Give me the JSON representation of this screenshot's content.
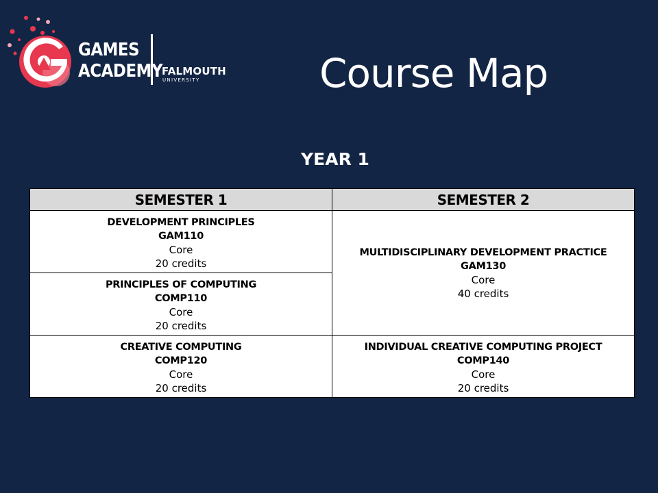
{
  "logo": {
    "line1": "GAMES",
    "line2": "ACADEMY",
    "institution": "FALMOUTH",
    "institution_sub": "UNIVERSITY"
  },
  "title": "Course Map",
  "year_heading": "YEAR 1",
  "table": {
    "headers": [
      "SEMESTER 1",
      "SEMESTER 2"
    ],
    "modules": {
      "dev_principles": {
        "name": "DEVELOPMENT PRINCIPLES",
        "code": "GAM110",
        "type": "Core",
        "credits": "20 credits"
      },
      "principles_computing": {
        "name": "PRINCIPLES OF COMPUTING",
        "code": "COMP110",
        "type": "Core",
        "credits": "20 credits"
      },
      "multidisciplinary": {
        "name": "MULTIDISCIPLINARY DEVELOPMENT PRACTICE",
        "code": "GAM130",
        "type": "Core",
        "credits": "40 credits"
      },
      "creative_computing": {
        "name": "CREATIVE COMPUTING",
        "code": "COMP120",
        "type": "Core",
        "credits": "20 credits"
      },
      "individual_project": {
        "name": "INDIVIDUAL CREATIVE COMPUTING PROJECT",
        "code": "COMP140",
        "type": "Core",
        "credits": "20 credits"
      }
    }
  },
  "colors": {
    "background": "#132544",
    "header_fill": "#d9d9d9",
    "logo_red": "#e8384f",
    "logo_pink": "#f2a7b6"
  }
}
